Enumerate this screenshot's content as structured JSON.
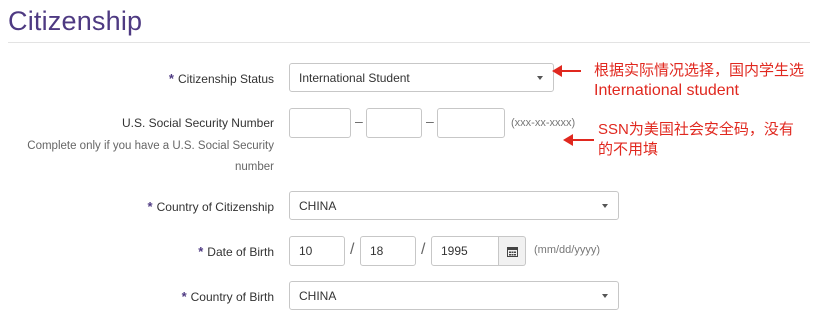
{
  "section_title": "Citizenship",
  "required_mark": "*",
  "fields": {
    "citizenship_status": {
      "label": "Citizenship Status",
      "value": "International Student"
    },
    "ssn": {
      "label": "U.S. Social Security Number",
      "hint": "Complete only if you have a U.S. Social Security number",
      "part1": "",
      "part2": "",
      "part3": "",
      "dash": "–",
      "format": "(xxx-xx-xxxx)"
    },
    "country_of_citizenship": {
      "label": "Country of Citizenship",
      "value": "CHINA"
    },
    "date_of_birth": {
      "label": "Date of Birth",
      "month": "10",
      "day": "18",
      "year": "1995",
      "slash": "/",
      "format": "(mm/dd/yyyy)"
    },
    "country_of_birth": {
      "label": "Country of Birth",
      "value": "CHINA"
    }
  },
  "annotations": {
    "status_note_line1": "根据实际情况选择，国内学生选",
    "status_note_line2": "International student",
    "ssn_note_line1": "SSN为美国社会安全码，没有",
    "ssn_note_line2": "的不用填"
  },
  "icons": {
    "calendar": "calendar-icon",
    "dropdown": "chevron-down-icon",
    "arrow": "red-arrow-icon"
  },
  "colors": {
    "accent": "#4e3a82",
    "annotation": "#e0281f"
  }
}
